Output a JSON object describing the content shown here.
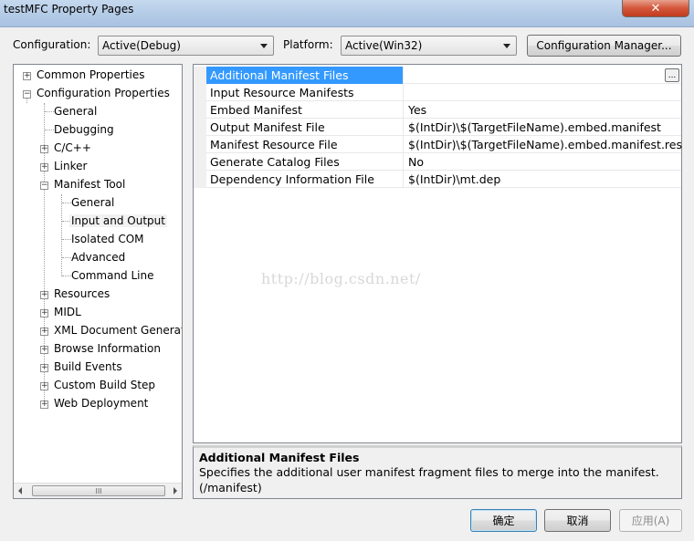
{
  "window": {
    "title": "testMFC Property Pages",
    "close_glyph": "✕"
  },
  "config": {
    "configuration_label": "Configuration:",
    "configuration_value": "Active(Debug)",
    "platform_label": "Platform:",
    "platform_value": "Active(Win32)",
    "manager_button": "Configuration Manager..."
  },
  "tree": {
    "common": "Common Properties",
    "config_props": "Configuration Properties",
    "general": "General",
    "debugging": "Debugging",
    "cpp": "C/C++",
    "linker": "Linker",
    "manifest_tool": "Manifest Tool",
    "mt_general": "General",
    "mt_input_output": "Input and Output",
    "mt_isolated_com": "Isolated COM",
    "mt_advanced": "Advanced",
    "mt_command_line": "Command Line",
    "resources": "Resources",
    "midl": "MIDL",
    "xml_doc": "XML Document Generat",
    "browse": "Browse Information",
    "build_events": "Build Events",
    "custom_build": "Custom Build Step",
    "web_deploy": "Web Deployment",
    "scroll_thumb_glyph": "III"
  },
  "grid": {
    "rows": [
      {
        "name": "Additional Manifest Files",
        "value": "",
        "button": "..."
      },
      {
        "name": "Input Resource Manifests",
        "value": ""
      },
      {
        "name": "Embed Manifest",
        "value": "Yes"
      },
      {
        "name": "Output Manifest File",
        "value": "$(IntDir)\\$(TargetFileName).embed.manifest"
      },
      {
        "name": "Manifest Resource File",
        "value": "$(IntDir)\\$(TargetFileName).embed.manifest.res"
      },
      {
        "name": "Generate Catalog Files",
        "value": "No"
      },
      {
        "name": "Dependency Information File",
        "value": "$(IntDir)\\mt.dep"
      }
    ]
  },
  "watermark": "http://blog.csdn.net/",
  "description": {
    "title": "Additional Manifest Files",
    "text": "Specifies the additional user manifest fragment files to merge into the manifest. (/manifest)"
  },
  "buttons": {
    "ok": "确定",
    "cancel": "取消",
    "apply": "应用(A)"
  }
}
